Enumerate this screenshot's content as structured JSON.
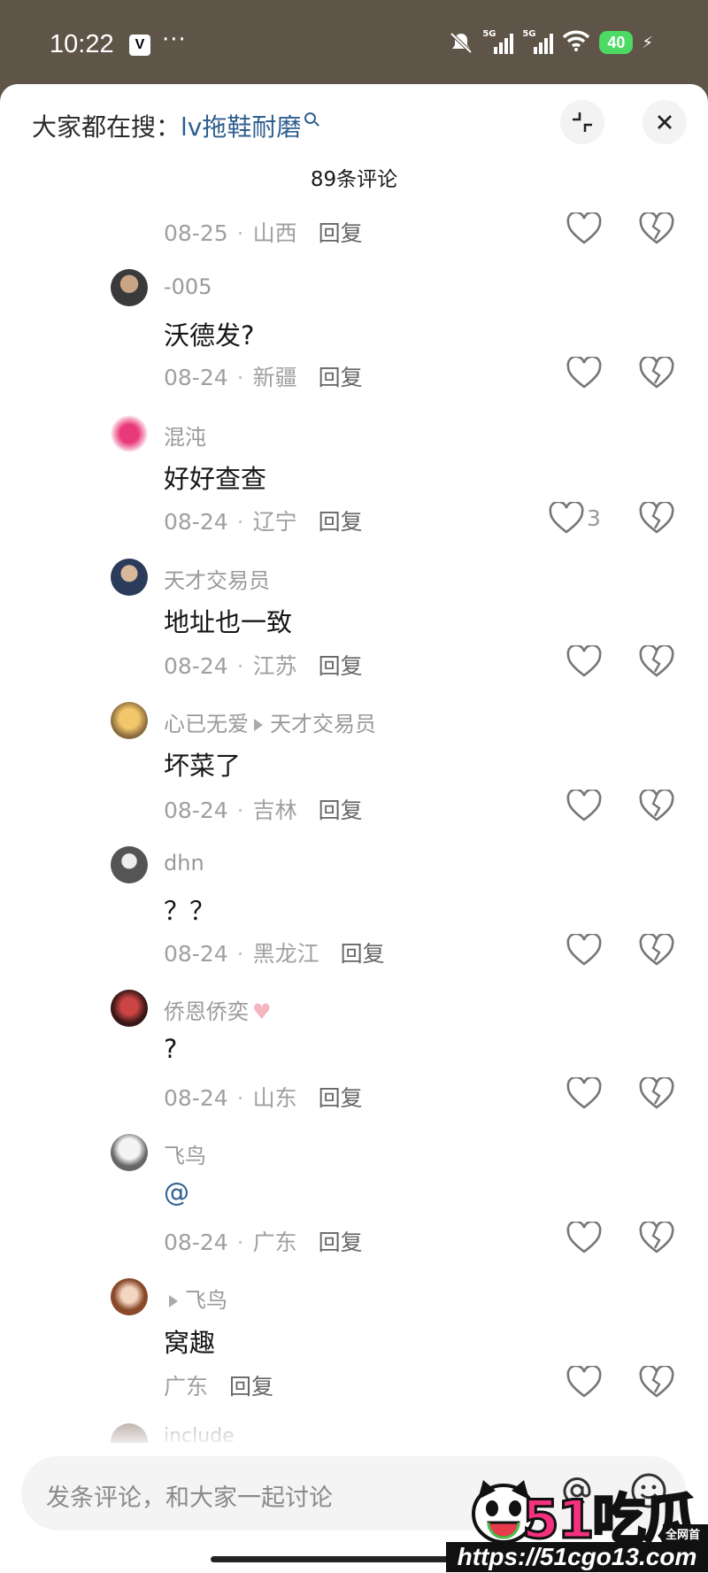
{
  "status_bar": {
    "time": "10:22",
    "app_icon": "V",
    "more": "···",
    "network_1": "5G",
    "network_2": "5G",
    "battery": "40",
    "icons": [
      "mute-bell-icon",
      "signal-icon",
      "signal-icon",
      "wifi-icon",
      "battery-icon",
      "charging-icon"
    ]
  },
  "header": {
    "search_prefix": "大家都在搜：",
    "search_term": "lv拖鞋耐磨",
    "comment_count": "89条评论"
  },
  "comments": [
    {
      "user": "",
      "text": "",
      "date": "08-25",
      "region": "山西",
      "reply": "回复",
      "likes": ""
    },
    {
      "user": "-005",
      "text": "沃德发?",
      "date": "08-24",
      "region": "新疆",
      "reply": "回复",
      "likes": ""
    },
    {
      "user": "混沌",
      "text": "好好查查",
      "date": "08-24",
      "region": "辽宁",
      "reply": "回复",
      "likes": "3"
    },
    {
      "user": "天才交易员",
      "text": "地址也一致",
      "date": "08-24",
      "region": "江苏",
      "reply": "回复",
      "likes": ""
    },
    {
      "user": "心已无爱",
      "reply_to": "天才交易员",
      "text": "坏菜了",
      "date": "08-24",
      "region": "吉林",
      "reply": "回复",
      "likes": ""
    },
    {
      "user": "dhn",
      "text": "？？",
      "date": "08-24",
      "region": "黑龙江",
      "reply": "回复",
      "likes": ""
    },
    {
      "user": "侨恩侨奕",
      "text": "?",
      "date": "08-24",
      "region": "山东",
      "reply": "回复",
      "likes": ""
    },
    {
      "user": "飞鸟",
      "text": "@",
      "date": "08-24",
      "region": "广东",
      "reply": "回复",
      "likes": ""
    },
    {
      "user": "",
      "reply_to": "飞鸟",
      "text": "窝趣",
      "date": "",
      "region": "广东",
      "reply": "回复",
      "likes": ""
    }
  ],
  "partial_next_user": "include",
  "input": {
    "placeholder": "发条评论，和大家一起讨论"
  },
  "watermark": {
    "logo": "51吃瓜",
    "tag": "全网首发",
    "url": "https://51cgo13.com"
  },
  "colors": {
    "link": "#2e5f8f",
    "muted": "#a0a0a0",
    "battery": "#4cd964",
    "watermark_pink": "#f5317f"
  }
}
